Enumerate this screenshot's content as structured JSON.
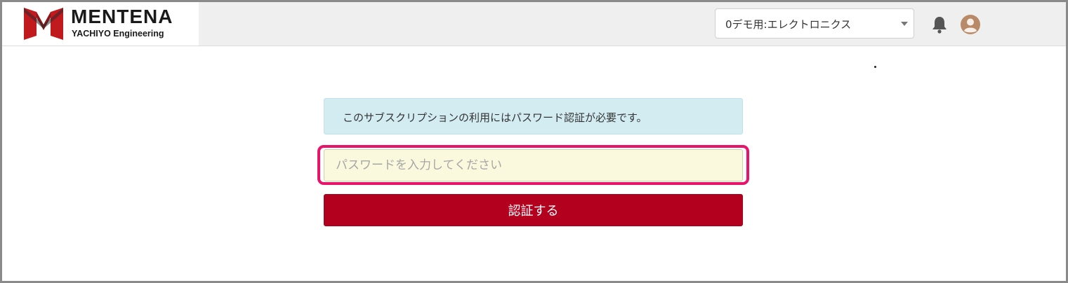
{
  "header": {
    "logo": {
      "title": "MENTENA",
      "subtitle": "YACHIYO Engineering"
    },
    "org_select": {
      "value": "0デモ用:エレクトロニクス"
    },
    "icons": {
      "notifications": "bell-icon",
      "user": "user-avatar-icon",
      "caret": "caret-down-icon"
    }
  },
  "main": {
    "alert_text": "このサブスクリプションの利用にはパスワード認証が必要です。",
    "password_placeholder": "パスワードを入力してください",
    "submit_label": "認証する"
  },
  "colors": {
    "topbar": "#efefef",
    "alert_bg": "#d2ecf1",
    "input_bg": "#faf9dd",
    "highlight": "#e8146a",
    "button": "#b3001e",
    "logo_red": "#c01a1f"
  }
}
